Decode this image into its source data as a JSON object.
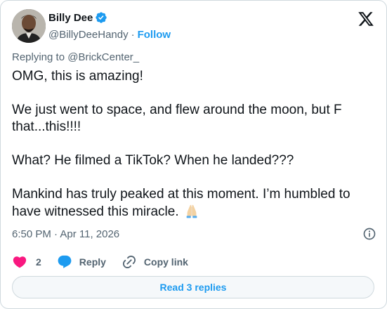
{
  "author": {
    "display_name": "Billy Dee",
    "handle": "@BillyDeeHandy",
    "follow_label": "Follow",
    "verified": true
  },
  "reply_context": {
    "prefix": "Replying to ",
    "handle": "@BrickCenter_"
  },
  "post": {
    "paragraphs": [
      "OMG, this is amazing!",
      "We just went to space, and flew around the moon, but F that...this!!!!",
      "What? He filmed a TikTok? When he landed???",
      "Mankind has truly peaked at this moment. I’m humbled to have witnessed this miracle."
    ],
    "emoji": "folded-hands"
  },
  "meta": {
    "timestamp": "6:50 PM · Apr 11, 2026"
  },
  "actions": {
    "like_count": "2",
    "reply_label": "Reply",
    "copy_link_label": "Copy link"
  },
  "read_replies_label": "Read 3 replies",
  "colors": {
    "accent": "#1d9bf0",
    "like": "#f91880",
    "text": "#0f1419",
    "muted": "#536471",
    "border": "#cfd9de"
  }
}
